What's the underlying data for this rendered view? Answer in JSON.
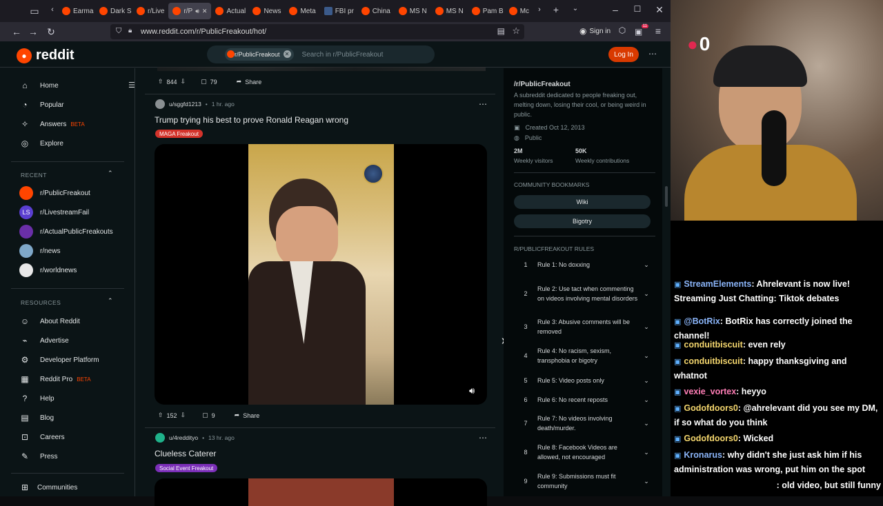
{
  "browser": {
    "tabs": [
      "Earma",
      "Dark S",
      "r/Live",
      "r/P",
      "Actual",
      "News",
      "Meta",
      "FBI pr",
      "China",
      "MS N",
      "MS N",
      "Pam B",
      "Mc"
    ],
    "url": "www.reddit.com/r/PublicFreakout/hot/",
    "sign_in": "Sign in",
    "badge_count": "11"
  },
  "reddit": {
    "logo": "reddit",
    "search_chip": "r/PublicFreakout",
    "search_placeholder": "Search in r/PublicFreakout",
    "login": "Log In",
    "nav": [
      {
        "label": "Home",
        "icon": "home-icon"
      },
      {
        "label": "Popular",
        "icon": "popular-icon"
      },
      {
        "label": "Answers",
        "icon": "answers-icon",
        "badge": "BETA"
      },
      {
        "label": "Explore",
        "icon": "explore-icon"
      }
    ],
    "recent_header": "RECENT",
    "recent": [
      {
        "label": "r/PublicFreakout",
        "color": "#ff4500",
        "abbr": ""
      },
      {
        "label": "r/LivestreamFail",
        "color": "#5b3fd1",
        "abbr": "LS"
      },
      {
        "label": "r/ActualPublicFreakouts",
        "color": "#6a2fa8",
        "abbr": ""
      },
      {
        "label": "r/news",
        "color": "#7fa8c9",
        "abbr": ""
      },
      {
        "label": "r/worldnews",
        "color": "#e8e8e8",
        "abbr": ""
      }
    ],
    "resources_header": "RESOURCES",
    "resources": [
      {
        "label": "About Reddit",
        "icon": "about-icon"
      },
      {
        "label": "Advertise",
        "icon": "advertise-icon"
      },
      {
        "label": "Developer Platform",
        "icon": "developer-icon"
      },
      {
        "label": "Reddit Pro",
        "icon": "pro-icon",
        "badge": "BETA"
      },
      {
        "label": "Help",
        "icon": "help-icon"
      },
      {
        "label": "Blog",
        "icon": "blog-icon"
      },
      {
        "label": "Careers",
        "icon": "careers-icon"
      },
      {
        "label": "Press",
        "icon": "press-icon"
      }
    ],
    "communities": "Communities"
  },
  "feed": {
    "prev_post": {
      "votes": "844",
      "comments": "79",
      "share": "Share"
    },
    "post1": {
      "user": "u/sggfd1213",
      "time": "1 hr. ago",
      "title": "Trump trying his best to prove Ronald Reagan wrong",
      "flair": "MAGA Freakout",
      "votes": "152",
      "comments": "9",
      "share": "Share"
    },
    "post2": {
      "user": "u/4reddityo",
      "time": "13 hr. ago",
      "title": "Clueless Caterer",
      "flair": "Social Event Freakout"
    }
  },
  "about": {
    "name": "/r/PublicFreakout",
    "description": "A subreddit dedicated to people freaking out, melting down, losing their cool, or being weird in public.",
    "created": "Created Oct 12, 2013",
    "visibility": "Public",
    "visitors_value": "2M",
    "visitors_label": "Weekly visitors",
    "contrib_value": "50K",
    "contrib_label": "Weekly contributions",
    "bookmarks_header": "COMMUNITY BOOKMARKS",
    "bookmarks": [
      "Wiki",
      "Bigotry"
    ],
    "rules_header": "R/PUBLICFREAKOUT RULES",
    "rules": [
      "Rule 1: No doxxing",
      "Rule 2: Use tact when commenting on videos involving mental disorders",
      "Rule 3: Abusive comments will be removed",
      "Rule 4: No racism, sexism, transphobia or bigotry",
      "Rule 5: Video posts only",
      "Rule 6: No recent reposts",
      "Rule 7: No videos involving death/murder.",
      "Rule 8: Facebook Videos are allowed, not encouraged",
      "Rule 9: Submissions must fit community"
    ]
  },
  "stream": {
    "counter": "0",
    "chat": [
      {
        "user": "StreamElements",
        "color": "#8ab4f8",
        "text": ": Ahrelevant is now live! Streaming Just Chatting: Tiktok debates"
      },
      {
        "user": "@BotRix",
        "color": "#8ab4f8",
        "text": ": BotRix has correctly joined the channel!"
      },
      {
        "user": "conduitbiscuit",
        "color": "#f5d76e",
        "text": ": even rely"
      },
      {
        "user": "conduitbiscuit",
        "color": "#f5d76e",
        "text": ": happy thanksgiving and whatnot"
      },
      {
        "user": "vexie_vortex",
        "color": "#ff7eb6",
        "text": ": heyyo"
      },
      {
        "user": "Godofdoors0",
        "color": "#f5d76e",
        "text": ": @ahrelevant did you see my DM, if so what do you think"
      },
      {
        "user": "Godofdoors0",
        "color": "#f5d76e",
        "text": ": Wicked"
      },
      {
        "user": "Kronarus",
        "color": "#8ab4f8",
        "text": ": why didn't she just ask him if his administration was wrong, put him on the spot"
      },
      {
        "user": "",
        "color": "#ffffff",
        "text": ": old video, but still funny"
      }
    ]
  }
}
